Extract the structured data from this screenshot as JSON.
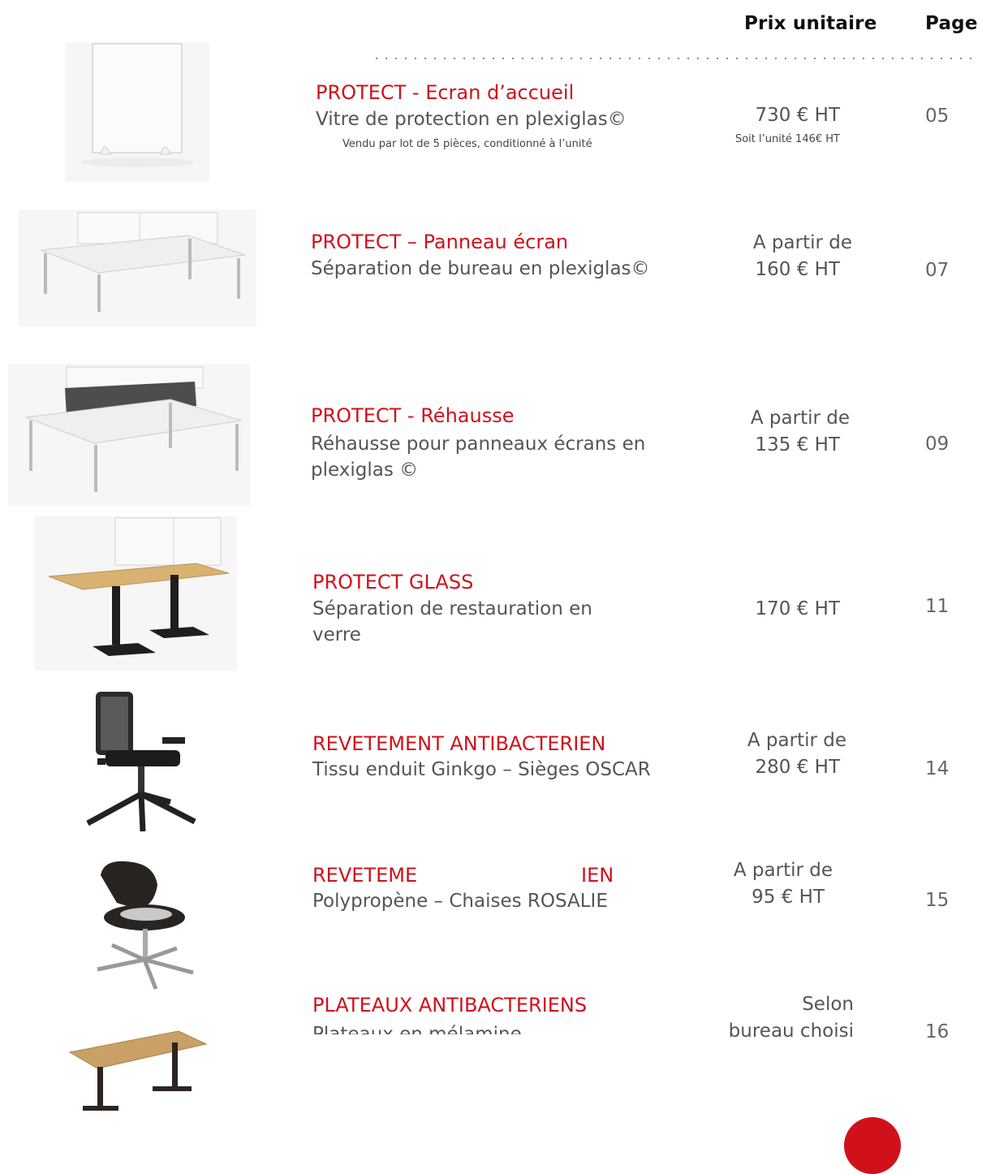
{
  "header": {
    "price_col": "Prix unitaire",
    "page_col": "Page"
  },
  "products": [
    {
      "title": "PROTECT - Ecran d’accueil",
      "desc": "Vitre de protection en plexiglas©",
      "note": "Vendu par lot de 5 pièces, conditionné à l’unité",
      "price": "730 € HT",
      "price_note": "Soit l’unité 146€ HT",
      "page": "05",
      "image": "plexiglass-screen-image"
    },
    {
      "title": "PROTECT – Panneau écran",
      "desc": "Séparation de bureau en plexiglas©",
      "price_line1": "A partir de",
      "price_line2": "160 € HT",
      "page": "07",
      "image": "desk-screen-image"
    },
    {
      "title": "PROTECT - Réhausse",
      "desc": "Réhausse pour panneaux écrans en plexiglas ©",
      "price_line1": "A partir de",
      "price_line2": "135 € HT",
      "page": "09",
      "image": "desk-raiser-image"
    },
    {
      "title": "PROTECT GLASS",
      "desc": "Séparation de restauration en verre",
      "price": "170 € HT",
      "page": "11",
      "image": "glass-table-image"
    },
    {
      "title": "REVETEMENT ANTIBACTERIEN",
      "desc": "Tissu enduit Ginkgo – Sièges OSCAR",
      "price_line1": "A partir de",
      "price_line2": "280 € HT",
      "page": "14",
      "image": "office-chair-image"
    },
    {
      "title_left": "REVETEME",
      "title_right": "IEN",
      "desc": "Polypropène – Chaises ROSALIE",
      "price_line1": "A partir de",
      "price_line2": "95 € HT",
      "page": "15",
      "image": "swivel-chair-image"
    },
    {
      "title": "PLATEAUX ANTIBACTERIENS",
      "desc": "Plateaux en mélamine",
      "price_line1": "Selon",
      "price_line2": "bureau choisi",
      "page": "16",
      "image": "table-top-image"
    }
  ],
  "colors": {
    "accent": "#d0111b",
    "text": "#555555",
    "header": "#111111"
  }
}
